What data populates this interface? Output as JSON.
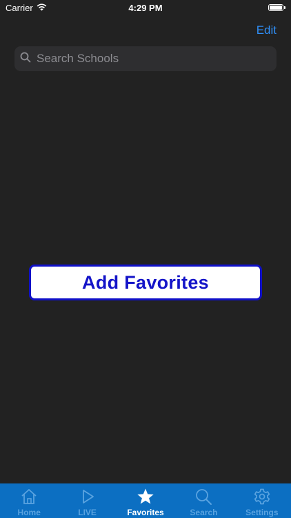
{
  "status_bar": {
    "carrier": "Carrier",
    "time": "4:29 PM"
  },
  "nav": {
    "edit_label": "Edit"
  },
  "search": {
    "placeholder": "Search Schools",
    "value": ""
  },
  "main": {
    "add_favorites_label": "Add Favorites"
  },
  "tab_bar": {
    "tabs": [
      {
        "label": "Home",
        "icon": "home-icon",
        "active": false
      },
      {
        "label": "LIVE",
        "icon": "play-icon",
        "active": false
      },
      {
        "label": "Favorites",
        "icon": "star-icon",
        "active": true
      },
      {
        "label": "Search",
        "icon": "search-icon",
        "active": false
      },
      {
        "label": "Settings",
        "icon": "gear-icon",
        "active": false
      }
    ]
  },
  "colors": {
    "background": "#222222",
    "accent": "#2f8ff8",
    "tab_bar": "#0c6fc2",
    "tab_inactive": "#5aa3e0",
    "button_border": "#1010c8"
  }
}
